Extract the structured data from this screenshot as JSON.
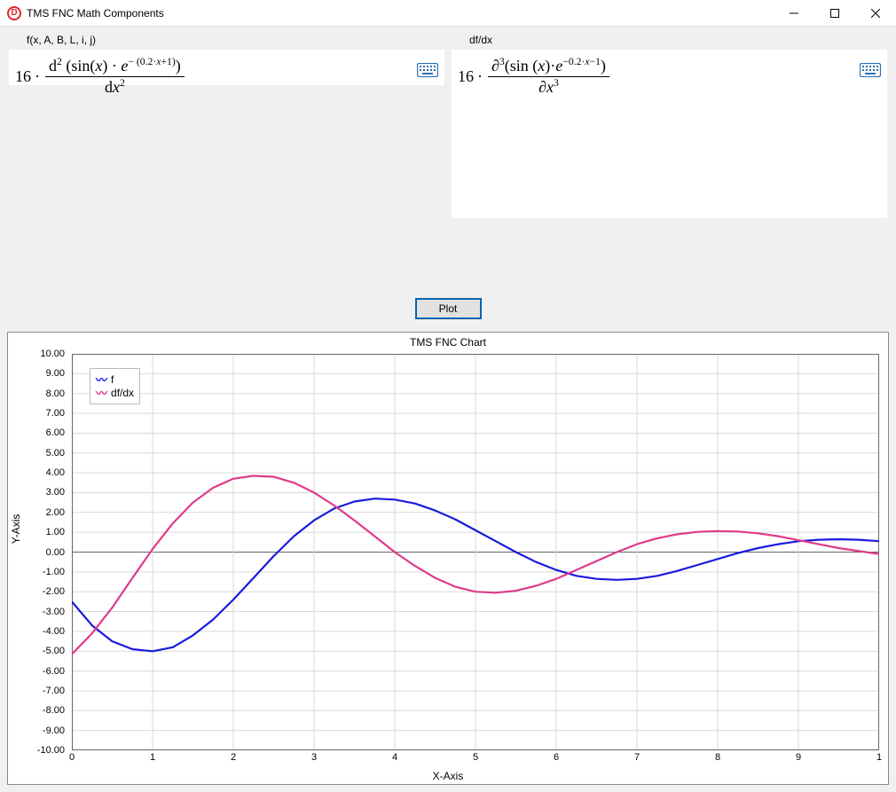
{
  "window": {
    "title": "TMS FNC Math Components"
  },
  "formula": {
    "left_label": "f(x, A, B, L, i, j)",
    "right_label": "df/dx",
    "left": {
      "coef": "16",
      "dot": "·",
      "num_prefix": "d",
      "num_sup": "2",
      "num_open": " (",
      "num_sin": "sin(",
      "num_x": "x",
      "num_sin_close": ")",
      "num_dot": " · ",
      "num_e": "e",
      "num_exp_prefix": "− (0.2·",
      "num_exp_x": "x",
      "num_exp_suffix": "+1)",
      "num_close": ")",
      "den_prefix": "d",
      "den_x": "x",
      "den_sup": "2"
    },
    "right": {
      "coef": "16",
      "dot": "·",
      "num_prefix": "∂",
      "num_sup": "3",
      "num_open": "(",
      "num_sin": "sin (",
      "num_x": "x",
      "num_sin_close": ")",
      "num_dot": "·",
      "num_e": "e",
      "num_exp_prefix": "−0.2·",
      "num_exp_x": "x",
      "num_exp_suffix": "−1",
      "num_close": ")",
      "den_prefix": "∂",
      "den_x": "x",
      "den_sup": "3"
    }
  },
  "button": {
    "plot": "Plot"
  },
  "chart_data": {
    "type": "line",
    "title": "TMS FNC Chart",
    "xlabel": "X-Axis",
    "ylabel": "Y-Axis",
    "xlim": [
      0,
      10
    ],
    "ylim": [
      -10,
      10
    ],
    "xticks": [
      0,
      1,
      2,
      3,
      4,
      5,
      6,
      7,
      8,
      9
    ],
    "yticks": [
      -10,
      -9,
      -8,
      -7,
      -6,
      -5,
      -4,
      -3,
      -2,
      -1,
      0,
      1,
      2,
      3,
      4,
      5,
      6,
      7,
      8,
      9,
      10
    ],
    "legend": [
      "f",
      "df/dx"
    ],
    "colors": {
      "f": "#1a1adf",
      "dfdx": "#e03a8a"
    },
    "series": [
      {
        "name": "f",
        "x": [
          0,
          0.25,
          0.5,
          0.75,
          1,
          1.25,
          1.5,
          1.75,
          2,
          2.25,
          2.5,
          2.75,
          3,
          3.25,
          3.5,
          3.75,
          4,
          4.25,
          4.5,
          4.75,
          5,
          5.25,
          5.5,
          5.75,
          6,
          6.25,
          6.5,
          6.75,
          7,
          7.25,
          7.5,
          7.75,
          8,
          8.25,
          8.5,
          8.75,
          9,
          9.25,
          9.5,
          9.75,
          10
        ],
        "values": [
          -2.5,
          -3.7,
          -4.5,
          -4.9,
          -5.0,
          -4.8,
          -4.2,
          -3.4,
          -2.4,
          -1.3,
          -0.2,
          0.8,
          1.6,
          2.2,
          2.55,
          2.7,
          2.65,
          2.45,
          2.1,
          1.65,
          1.1,
          0.55,
          0.0,
          -0.5,
          -0.9,
          -1.2,
          -1.35,
          -1.4,
          -1.35,
          -1.2,
          -0.95,
          -0.65,
          -0.35,
          -0.05,
          0.2,
          0.4,
          0.55,
          0.62,
          0.65,
          0.62,
          0.55
        ]
      },
      {
        "name": "df/dx",
        "x": [
          0,
          0.25,
          0.5,
          0.75,
          1,
          1.25,
          1.5,
          1.75,
          2,
          2.25,
          2.5,
          2.75,
          3,
          3.25,
          3.5,
          3.75,
          4,
          4.25,
          4.5,
          4.75,
          5,
          5.25,
          5.5,
          5.75,
          6,
          6.25,
          6.5,
          6.75,
          7,
          7.25,
          7.5,
          7.75,
          8,
          8.25,
          8.5,
          8.75,
          9,
          9.25,
          9.5,
          9.75,
          10
        ],
        "values": [
          -5.15,
          -4.1,
          -2.8,
          -1.3,
          0.15,
          1.45,
          2.5,
          3.25,
          3.7,
          3.85,
          3.8,
          3.5,
          3.0,
          2.35,
          1.6,
          0.8,
          0.0,
          -0.7,
          -1.3,
          -1.75,
          -2.0,
          -2.05,
          -1.95,
          -1.7,
          -1.35,
          -0.9,
          -0.45,
          0.0,
          0.4,
          0.7,
          0.9,
          1.02,
          1.06,
          1.04,
          0.95,
          0.8,
          0.6,
          0.4,
          0.2,
          0.05,
          -0.1
        ]
      }
    ]
  }
}
